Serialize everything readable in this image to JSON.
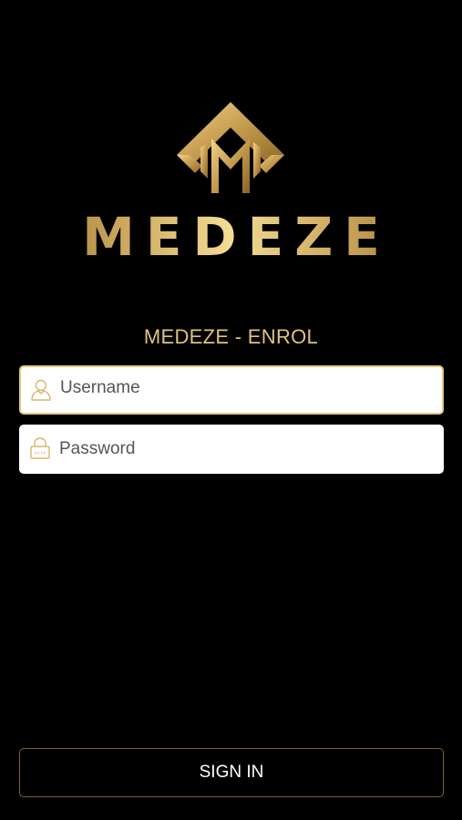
{
  "brand": {
    "name": "MEDEZE",
    "logo_icon": "diamond-m-logo-icon",
    "gold_light": "#f3dc94",
    "gold_dark": "#8e6a2e"
  },
  "screen": {
    "title": "MEDEZE - ENROL"
  },
  "form": {
    "username": {
      "icon": "user-icon",
      "placeholder": "Username",
      "value": ""
    },
    "password": {
      "icon": "lock-icon",
      "placeholder": "Password",
      "value": ""
    },
    "submit_label": "SIGN IN"
  },
  "colors": {
    "background": "#000000",
    "accent": "#e0c27c",
    "button_border": "#7b6329"
  }
}
